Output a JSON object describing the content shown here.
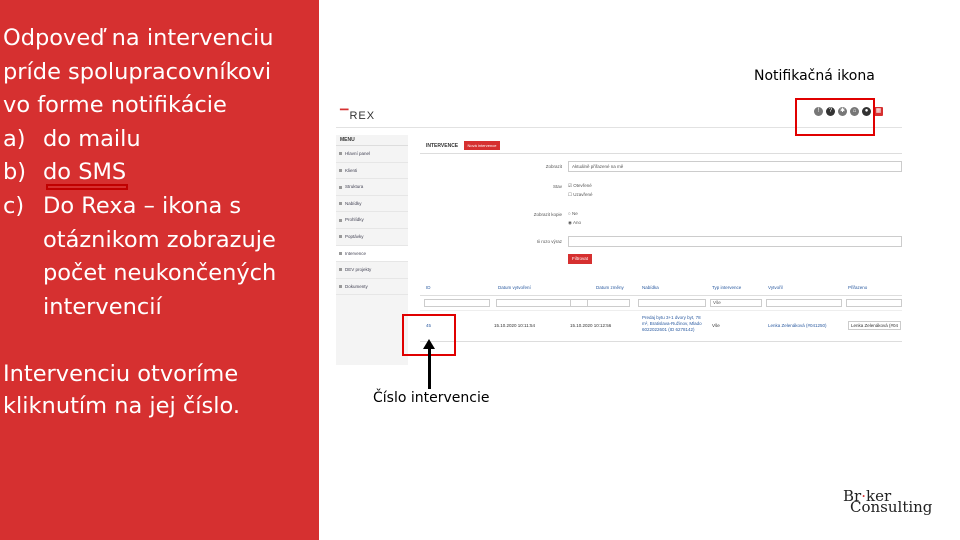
{
  "left": {
    "intro_lines": [
      "Odpoveď na intervenciu",
      "príde spolupracovníkovi",
      "vo forme notifikácie"
    ],
    "list": [
      {
        "marker": "a)",
        "lines": [
          "do mailu"
        ]
      },
      {
        "marker": "b)",
        "lines": [
          "do SMS"
        ]
      },
      {
        "marker": "c)",
        "lines": [
          "Do Rexa – ikona s",
          "otáznikom zobrazuje",
          "počet neukončených",
          "intervencií"
        ]
      }
    ],
    "bottom_lines": [
      "Intervenciu otvoríme",
      "kliknutím na jej číslo."
    ]
  },
  "captions": {
    "notif": "Notifikačná ikona",
    "id": "Číslo intervencie"
  },
  "rex": {
    "logo": "REX",
    "menu_title": "MENU",
    "menu_items": [
      "Hlavní panel",
      "Klienti",
      "Struktura",
      "Nabídky",
      "Prohlídky",
      "Poptávky",
      "Intervence",
      "DEV projekty",
      "Dokumenty"
    ],
    "active_item": "Intervence",
    "page_title": "INTERVENCE",
    "new_button": "Nová intervence",
    "form": {
      "zobrazit_label": "Zobrazit",
      "zobrazit_value": "Aktuálně přiřazené na mě",
      "stav_label": "Stav",
      "stav_options": [
        "Otevřené",
        "Uzavřené"
      ],
      "zobrazit_kopie_label": "Zobrazit kopie",
      "kopie_options": [
        "Ne",
        "Ano"
      ],
      "vyraz_label": "Iii rozo výraz",
      "filter_button": "Filtrovat"
    },
    "grid": {
      "headers": [
        "ID",
        "Datum vytvoření",
        "Datum změny",
        "Nabídka",
        "Typ intervence",
        "Vytvořil",
        "Přiřazeno"
      ],
      "filter_select": "Vše",
      "row": {
        "id": "45",
        "created": "15.10.2020 10:11:54",
        "changed": "15.10.2020 10:12:56",
        "offer": "Predaj bytu 3+1 dvory byt, 78 m², Bratislava-Ružinov, Mlado 6022022601 (ID 6278142)",
        "type": "Vše",
        "author": "Lenka Zelenáková (#041250)",
        "assigned": "Lenka Zelenáková (#04"
      }
    }
  },
  "logo": {
    "line1_a": "Br",
    "line1_b": "ker",
    "line2": "Consulting"
  },
  "colors": {
    "panel_red": "#d63030",
    "highlight_red": "#e00000"
  }
}
